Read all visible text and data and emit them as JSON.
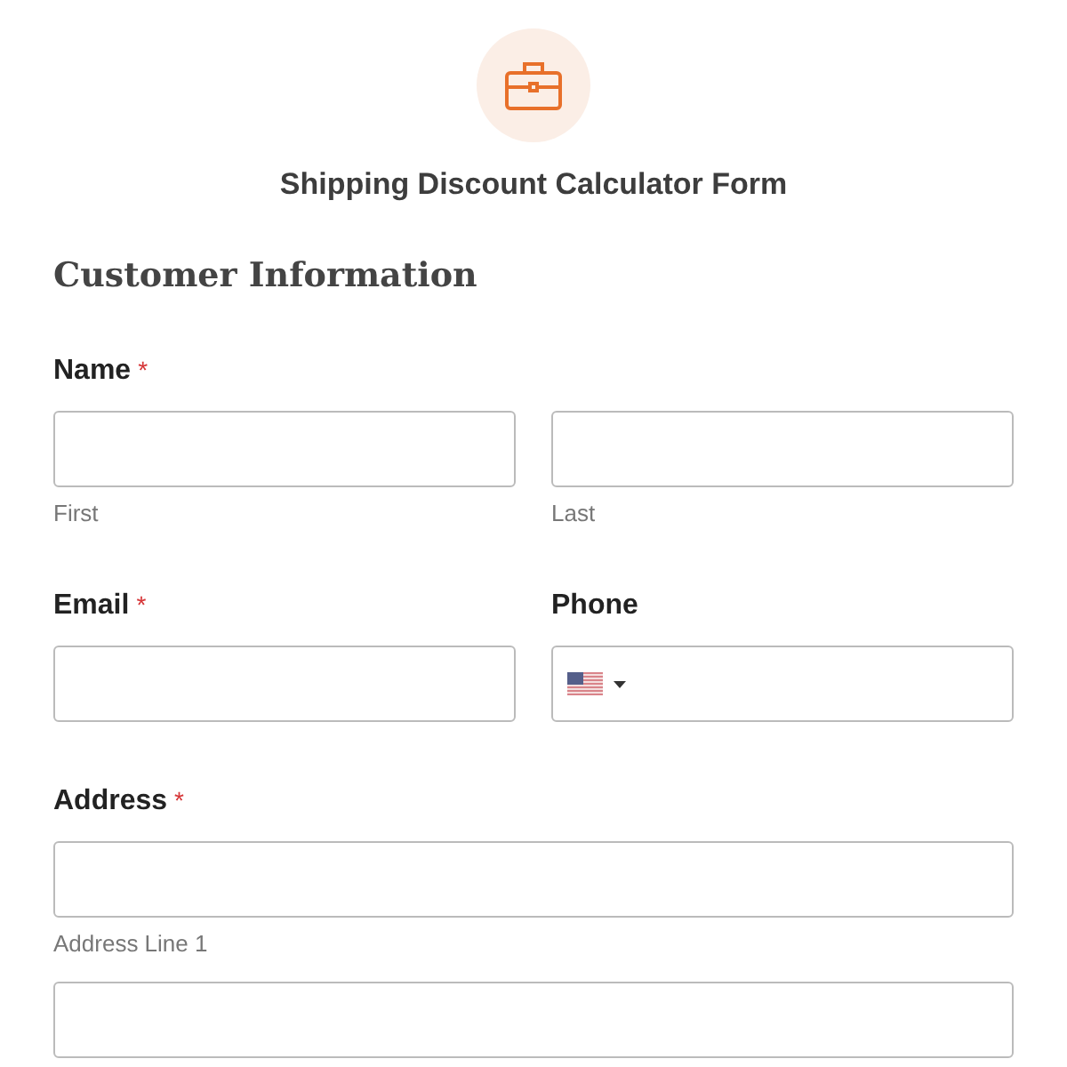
{
  "form": {
    "title": "Shipping Discount Calculator Form",
    "section_heading": "Customer Information",
    "rows": [
      {
        "fields": [
          {
            "label": "Name",
            "required_mark": "*",
            "inputs": [
              {
                "kind": "text",
                "sublabel": "First"
              },
              {
                "kind": "text",
                "sublabel": "Last"
              }
            ]
          }
        ]
      },
      {
        "fields": [
          {
            "label": "Email",
            "required_mark": "*",
            "inputs": [
              {
                "kind": "text"
              }
            ]
          },
          {
            "label": "Phone",
            "inputs": [
              {
                "kind": "phone"
              }
            ]
          }
        ]
      },
      {
        "fields": [
          {
            "label": "Address",
            "required_mark": "*",
            "inputs": [
              {
                "kind": "wide",
                "sublabel": "Address Line 1"
              },
              {
                "kind": "wide"
              }
            ]
          }
        ]
      }
    ]
  }
}
